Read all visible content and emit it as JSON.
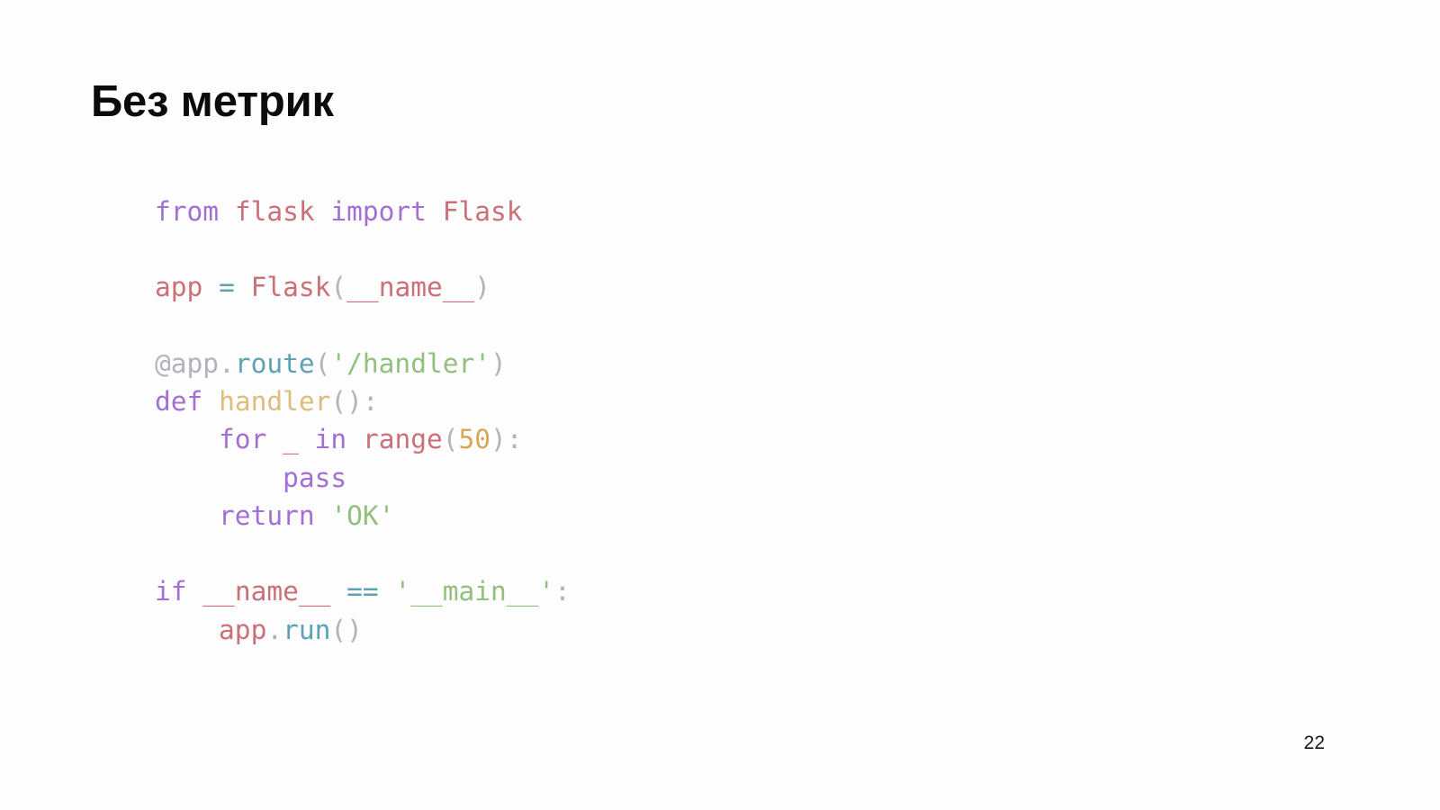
{
  "slide": {
    "title": "Без метрик",
    "page_number": "22",
    "background_color": "#fdfdfe"
  },
  "code": {
    "language": "python",
    "plain_text": "from flask import Flask\n\napp = Flask(__name__)\n\n@app.route('/handler')\ndef handler():\n    for _ in range(50):\n        pass\n    return 'OK'\n\nif __name__ == '__main__':\n    app.run()",
    "lines": [
      {
        "id": "line-1",
        "tokens": [
          {
            "text": "from",
            "type": "keyword"
          },
          {
            "text": " ",
            "type": "plain"
          },
          {
            "text": "flask",
            "type": "name"
          },
          {
            "text": " ",
            "type": "plain"
          },
          {
            "text": "import",
            "type": "keyword"
          },
          {
            "text": " ",
            "type": "plain"
          },
          {
            "text": "Flask",
            "type": "name"
          }
        ]
      },
      {
        "id": "line-2",
        "tokens": []
      },
      {
        "id": "line-3",
        "tokens": [
          {
            "text": "app",
            "type": "name"
          },
          {
            "text": " ",
            "type": "plain"
          },
          {
            "text": "=",
            "type": "operator"
          },
          {
            "text": " ",
            "type": "plain"
          },
          {
            "text": "Flask",
            "type": "name"
          },
          {
            "text": "(",
            "type": "punctuation"
          },
          {
            "text": "__name__",
            "type": "name"
          },
          {
            "text": ")",
            "type": "punctuation"
          }
        ]
      },
      {
        "id": "line-4",
        "tokens": []
      },
      {
        "id": "line-5",
        "tokens": [
          {
            "text": "@app",
            "type": "decorator"
          },
          {
            "text": ".",
            "type": "punctuation"
          },
          {
            "text": "route",
            "type": "operator"
          },
          {
            "text": "(",
            "type": "punctuation"
          },
          {
            "text": "'/handler'",
            "type": "string"
          },
          {
            "text": ")",
            "type": "punctuation"
          }
        ]
      },
      {
        "id": "line-6",
        "tokens": [
          {
            "text": "def",
            "type": "keyword"
          },
          {
            "text": " ",
            "type": "plain"
          },
          {
            "text": "handler",
            "type": "function"
          },
          {
            "text": "():",
            "type": "punctuation"
          }
        ]
      },
      {
        "id": "line-7",
        "tokens": [
          {
            "text": "    ",
            "type": "plain"
          },
          {
            "text": "for",
            "type": "keyword"
          },
          {
            "text": " ",
            "type": "plain"
          },
          {
            "text": "_",
            "type": "name"
          },
          {
            "text": " ",
            "type": "plain"
          },
          {
            "text": "in",
            "type": "keyword"
          },
          {
            "text": " ",
            "type": "plain"
          },
          {
            "text": "range",
            "type": "name"
          },
          {
            "text": "(",
            "type": "punctuation"
          },
          {
            "text": "50",
            "type": "number"
          },
          {
            "text": "):",
            "type": "punctuation"
          }
        ]
      },
      {
        "id": "line-8",
        "tokens": [
          {
            "text": "        ",
            "type": "plain"
          },
          {
            "text": "pass",
            "type": "keyword"
          }
        ]
      },
      {
        "id": "line-9",
        "tokens": [
          {
            "text": "    ",
            "type": "plain"
          },
          {
            "text": "return",
            "type": "keyword"
          },
          {
            "text": " ",
            "type": "plain"
          },
          {
            "text": "'OK'",
            "type": "string"
          }
        ]
      },
      {
        "id": "line-10",
        "tokens": []
      },
      {
        "id": "line-11",
        "tokens": [
          {
            "text": "if",
            "type": "keyword"
          },
          {
            "text": " ",
            "type": "plain"
          },
          {
            "text": "__name__",
            "type": "name"
          },
          {
            "text": " ",
            "type": "plain"
          },
          {
            "text": "==",
            "type": "operator"
          },
          {
            "text": " ",
            "type": "plain"
          },
          {
            "text": "'__main__'",
            "type": "string"
          },
          {
            "text": ":",
            "type": "punctuation"
          }
        ]
      },
      {
        "id": "line-12",
        "tokens": [
          {
            "text": "    ",
            "type": "plain"
          },
          {
            "text": "app",
            "type": "name"
          },
          {
            "text": ".",
            "type": "punctuation"
          },
          {
            "text": "run",
            "type": "operator"
          },
          {
            "text": "()",
            "type": "punctuation"
          }
        ]
      }
    ],
    "colors": {
      "keyword": "#a36fd4",
      "name": "#cc7078",
      "operator": "#5ba3b2",
      "string": "#93bf7e",
      "function": "#ddbd7c",
      "number": "#d4a857",
      "punctuation": "#b2b2bd",
      "decorator": "#b2b2bd",
      "plain": "#b2b2bd"
    }
  }
}
